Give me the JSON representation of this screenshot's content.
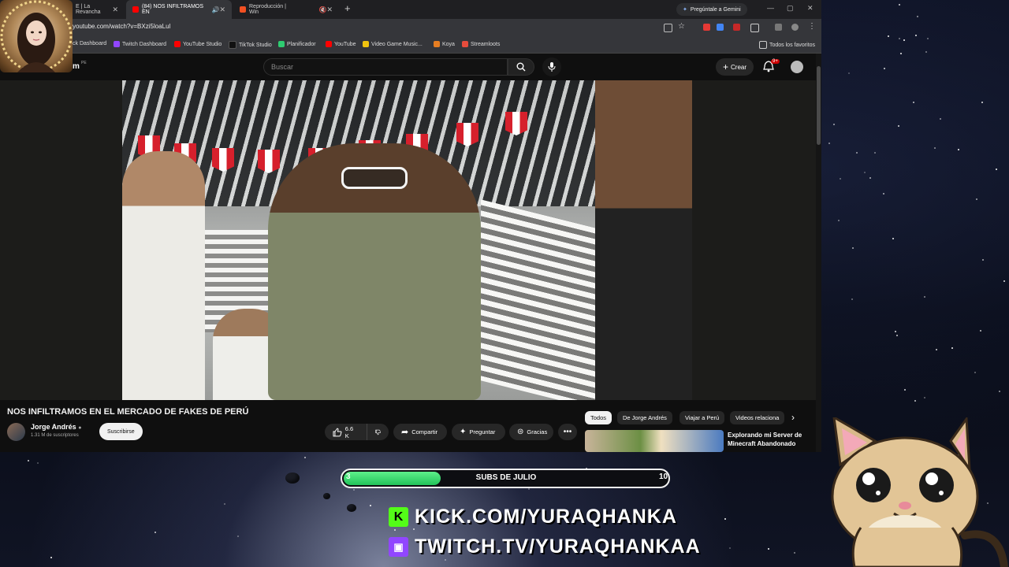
{
  "browser": {
    "tabs": [
      {
        "label": "E | La Revancha",
        "color": "#ff3b30"
      },
      {
        "label": "(84) NOS INFILTRAMOS EN",
        "color": "#ff0000"
      },
      {
        "label": "Reproducción | Win",
        "color": "#f25022"
      }
    ],
    "gemini_label": "Pregúntale a Gemini",
    "url": "youtube.com/watch?v=BXzi5loaLul",
    "bookmarks": [
      {
        "label": "ck Dashboard",
        "color": "#3ddc84"
      },
      {
        "label": "Twitch Dashboard",
        "color": "#9146ff"
      },
      {
        "label": "YouTube Studio",
        "color": "#ff0000"
      },
      {
        "label": "TikTok Studio",
        "color": "#222222"
      },
      {
        "label": "Planificador",
        "color": "#2ecc71"
      },
      {
        "label": "YouTube",
        "color": "#ff0000"
      },
      {
        "label": "Video Game Music...",
        "color": "#f1c40f"
      },
      {
        "label": "Koya",
        "color": "#e67e22"
      },
      {
        "label": "Streamloots",
        "color": "#e74c3c"
      }
    ],
    "all_favorites": "Todos los favoritos"
  },
  "youtube": {
    "logo_m": "m",
    "logo_region": "PE",
    "search_placeholder": "Buscar",
    "create_label": "Crear",
    "notif_badge": "9+",
    "video_title": "NOS INFILTRAMOS EN EL MERCADO DE FAKES DE PERÚ",
    "channel_name": "Jorge Andrés",
    "channel_subs": "1.31 M de suscriptores",
    "subscribe_label": "Suscribirse",
    "likes": "6.6 K",
    "share_label": "Compartir",
    "ask_label": "Preguntar",
    "thanks_label": "Gracias",
    "chips": [
      "Todos",
      "De Jorge Andrés",
      "Viajar a Perú",
      "Videos relaciona"
    ],
    "rec_title": "Explorando mi Server de Minecraft Abandonado"
  },
  "overlay": {
    "goal_title": "SUBS DE JULIO",
    "goal_current": "3",
    "goal_target": "10",
    "goal_progress": 0.3,
    "kick_url": "KICK.COM/YURAQHANKA",
    "twitch_url": "TWITCH.TV/YURAQHANKAA",
    "kick_color": "#53fc18",
    "twitch_color": "#9146ff"
  }
}
